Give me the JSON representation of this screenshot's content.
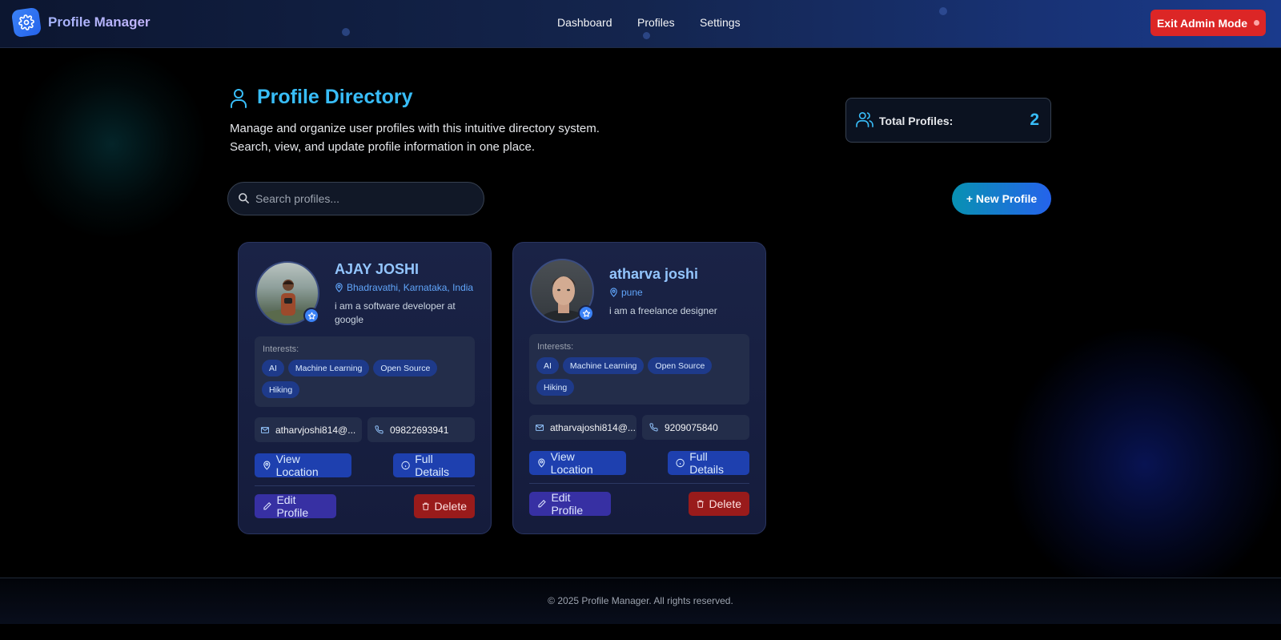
{
  "header": {
    "brand": "Profile Manager",
    "nav": [
      "Dashboard",
      "Profiles",
      "Settings"
    ],
    "exit_label": "Exit Admin Mode"
  },
  "main": {
    "title": "Profile Directory",
    "subtitle_line1": "Manage and organize user profiles with this intuitive directory system.",
    "subtitle_line2": "Search, view, and update profile information in one place.",
    "stats": {
      "label": "Total Profiles:",
      "value": "2"
    },
    "search": {
      "placeholder": "Search profiles..."
    },
    "new_button": "+ New Profile"
  },
  "labels": {
    "interests": "Interests:",
    "view_location": "View Location",
    "full_details": "Full Details",
    "edit_profile": "Edit Profile",
    "delete": "Delete"
  },
  "profiles": [
    {
      "name": "AJAY JOSHI",
      "location": "Bhadravathi, Karnataka, India",
      "bio": "i am a software developer at google",
      "interests": [
        "AI",
        "Machine Learning",
        "Open Source",
        "Hiking"
      ],
      "email": "atharvjoshi814@...",
      "phone": "09822693941"
    },
    {
      "name": "atharva joshi",
      "location": "pune",
      "bio": "i am a freelance designer",
      "interests": [
        "AI",
        "Machine Learning",
        "Open Source",
        "Hiking"
      ],
      "email": "atharvajoshi814@...",
      "phone": "9209075840"
    }
  ],
  "footer": {
    "text": "© 2025 Profile Manager. All rights reserved."
  },
  "colors": {
    "accent": "#38bdf8",
    "danger": "#dc2626",
    "chip": "#1e3a8a",
    "card_bg": "#1a2346"
  },
  "icons": [
    "gear-icon",
    "user-icon",
    "users-icon",
    "search-icon",
    "map-pin-icon",
    "mail-icon",
    "phone-icon",
    "info-icon",
    "pencil-icon",
    "trash-icon",
    "star-icon"
  ]
}
